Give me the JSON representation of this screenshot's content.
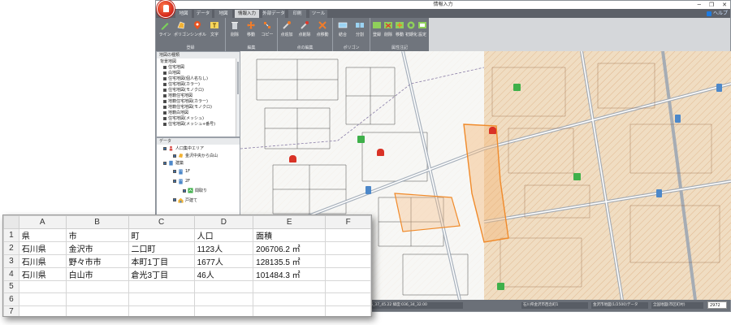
{
  "window": {
    "title": "情報入力",
    "close_glyph": "✕",
    "restore_glyph": "❐",
    "minimize_glyph": "─"
  },
  "ribbon_tabs": [
    {
      "label": "地図",
      "active": false
    },
    {
      "label": "データ",
      "active": false
    },
    {
      "label": "地図",
      "active": false
    },
    {
      "label": "情報入力",
      "active": true
    },
    {
      "label": "外部データ",
      "active": false
    },
    {
      "label": "印刷",
      "active": false
    },
    {
      "label": "ツール",
      "active": false
    }
  ],
  "help_label": "ヘルプ",
  "ribbon_groups": [
    {
      "label": "登録",
      "buttons": [
        {
          "label": "ライン",
          "icon": "pencil-icon"
        },
        {
          "label": "ポリゴン",
          "icon": "polygon-icon"
        },
        {
          "label": "シンボル",
          "icon": "pin-icon"
        },
        {
          "label": "文字",
          "icon": "text-icon"
        }
      ]
    },
    {
      "label": "編集",
      "buttons": [
        {
          "label": "削除",
          "icon": "trash-icon"
        },
        {
          "label": "移動",
          "icon": "move-icon"
        },
        {
          "label": "コピー",
          "icon": "copy-icon"
        }
      ]
    },
    {
      "label": "点の編集",
      "buttons": [
        {
          "label": "点追加",
          "icon": "add-point-icon"
        },
        {
          "label": "点削除",
          "icon": "delete-point-icon"
        },
        {
          "label": "点移動",
          "icon": "move-point-icon"
        }
      ]
    },
    {
      "label": "ポリゴン",
      "buttons": [
        {
          "label": "結合",
          "icon": "merge-icon"
        },
        {
          "label": "分割",
          "icon": "split-icon"
        }
      ]
    },
    {
      "label": "属性注記",
      "buttons": [
        {
          "label": "登録",
          "icon": "note-add-icon"
        },
        {
          "label": "削除",
          "icon": "note-delete-icon"
        },
        {
          "label": "移動",
          "icon": "note-move-icon"
        },
        {
          "label": "初期化",
          "icon": "reset-icon"
        },
        {
          "label": "設定",
          "icon": "settings-icon"
        }
      ]
    }
  ],
  "layer_panel": {
    "header": "地図の種類",
    "root": "背景地図",
    "items": [
      "住宅地図",
      "白地図",
      "住宅地図(個人名なし)",
      "住宅地図(カラー)",
      "住宅地図(モノクロ)",
      "地籍住宅地図",
      "地籍住宅地図(カラー)",
      "地籍住宅地図(モノクロ)",
      "地籍白地図",
      "住宅地図(メッシュ)",
      "住宅地図(メッシュ+番号)"
    ]
  },
  "data_panel": {
    "header": "データ",
    "items": [
      {
        "label": "人口集中エリア",
        "level": 1
      },
      {
        "label": "金沢中央から白山",
        "level": 2
      },
      {
        "label": "建築",
        "level": 1
      },
      {
        "label": "1F",
        "level": 2
      },
      {
        "label": "2F",
        "level": 2
      },
      {
        "label": "間取り",
        "level": 3
      },
      {
        "label": "戸建て",
        "level": 2
      }
    ]
  },
  "status_bar": {
    "fields": [
      "経度:136_37_45.22 緯度:036_34_32.00",
      "石川県金沢市西念町1",
      "金沢市地図(1/2500)データ",
      "全国地図(市区町村)"
    ],
    "scale_value": "2972"
  },
  "spreadsheet": {
    "columns": [
      "A",
      "B",
      "C",
      "D",
      "E",
      "F"
    ],
    "row_numbers": [
      "1",
      "2",
      "3",
      "4",
      "5",
      "6",
      "7"
    ],
    "rows": [
      [
        "県",
        "市",
        "町",
        "人口",
        "面積",
        ""
      ],
      [
        "石川県",
        "金沢市",
        "二口町",
        "1123人",
        "206706.2 ㎡",
        ""
      ],
      [
        "石川県",
        "野々市市",
        "本町1丁目",
        "1677人",
        "128135.5 ㎡",
        ""
      ],
      [
        "石川県",
        "白山市",
        "倉光3丁目",
        "46人",
        "101484.3 ㎡",
        ""
      ],
      [
        "",
        "",
        "",
        "",
        "",
        ""
      ],
      [
        "",
        "",
        "",
        "",
        "",
        ""
      ],
      [
        "",
        "",
        "",
        "",
        "",
        ""
      ]
    ]
  },
  "colors": {
    "map_parcel": "#f0ddc2",
    "map_street": "#9aa5b3",
    "highlight_boundary": "#f08a2a",
    "poi_green": "#3fb04a",
    "poi_red": "#d93226",
    "poi_blue": "#4d88c9"
  }
}
